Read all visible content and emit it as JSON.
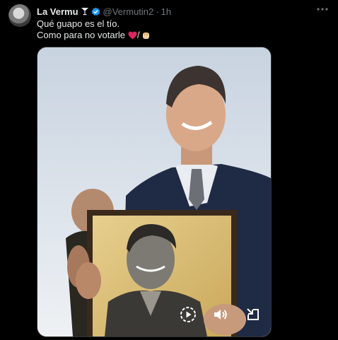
{
  "tweet": {
    "author_name": "La Vermu",
    "handle": "@Vermutin2",
    "separator": "·",
    "time": "1h",
    "text_line1": "Qué guapo es el tío.",
    "text_line2": "Como para no votarle",
    "text_slash": "/",
    "icons": {
      "name_emoji": "cocktail-glass-icon",
      "verified": "verified-badge-icon",
      "more": "more-options-icon",
      "heart": "red-heart-icon",
      "hand": "raised-fist-icon"
    }
  },
  "media": {
    "type": "video",
    "controls": [
      "play-icon",
      "volume-icon",
      "exit-fullscreen-icon"
    ]
  },
  "colors": {
    "background": "#000000",
    "text_primary": "#e7e9ea",
    "text_secondary": "#71767b",
    "verified": "#1d9bf0",
    "heart": "#f91880"
  }
}
